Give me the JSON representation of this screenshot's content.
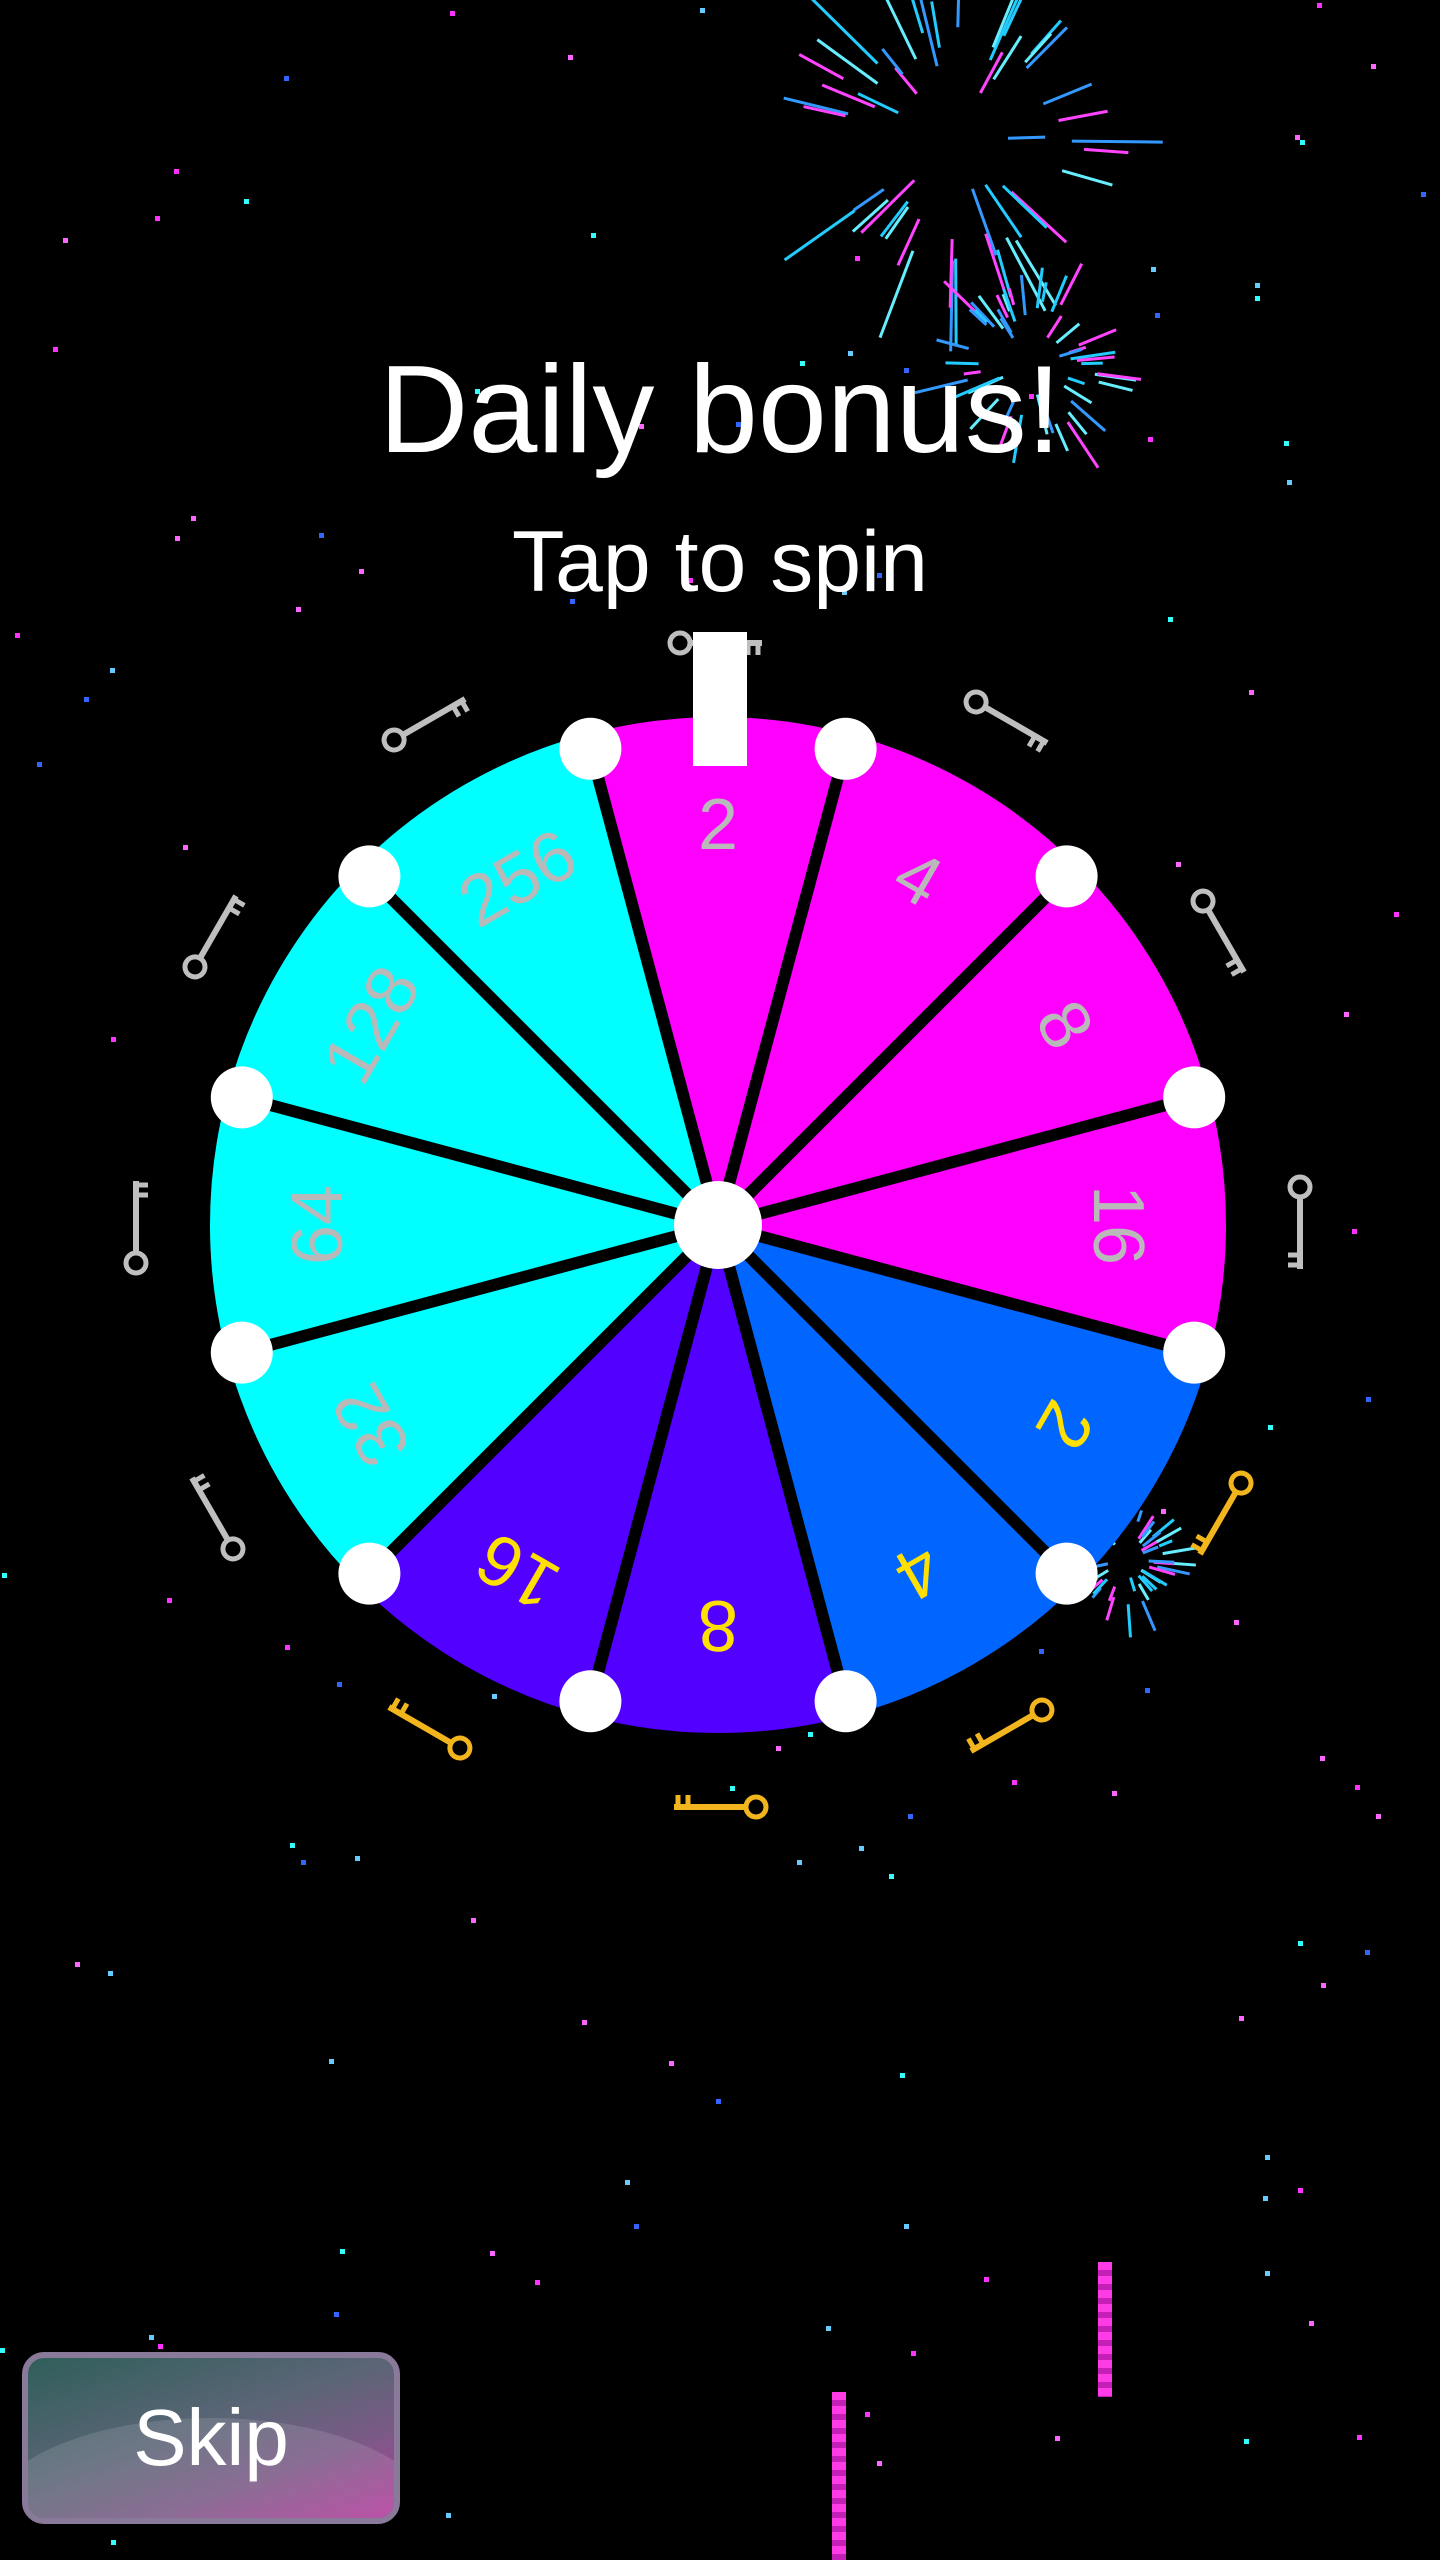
{
  "title": "Daily bonus!",
  "subtitle": "Tap to spin",
  "skip_label": "Skip",
  "wheel": {
    "segments": [
      {
        "value": "2",
        "color": "#ff00ff",
        "text_color": "#b9b9b9",
        "key": "silver"
      },
      {
        "value": "4",
        "color": "#ff00ff",
        "text_color": "#b9b9b9",
        "key": "silver"
      },
      {
        "value": "8",
        "color": "#ff00ff",
        "text_color": "#b9b9b9",
        "key": "silver"
      },
      {
        "value": "16",
        "color": "#ff00ff",
        "text_color": "#b9b9b9",
        "key": "silver"
      },
      {
        "value": "2",
        "color": "#0066ff",
        "text_color": "#ffe000",
        "key": "gold"
      },
      {
        "value": "4",
        "color": "#0066ff",
        "text_color": "#ffe000",
        "key": "gold"
      },
      {
        "value": "8",
        "color": "#5200ff",
        "text_color": "#ffe000",
        "key": "gold"
      },
      {
        "value": "16",
        "color": "#5200ff",
        "text_color": "#ffe000",
        "key": "gold"
      },
      {
        "value": "32",
        "color": "#00ffff",
        "text_color": "#b9b9b9",
        "key": "silver"
      },
      {
        "value": "64",
        "color": "#00ffff",
        "text_color": "#b9b9b9",
        "key": "silver"
      },
      {
        "value": "128",
        "color": "#00ffff",
        "text_color": "#b9b9b9",
        "key": "silver"
      },
      {
        "value": "256",
        "color": "#00ffff",
        "text_color": "#b9b9b9",
        "key": "silver"
      }
    ]
  },
  "colors": {
    "background": "#000000",
    "silver_key": "#bfbfbf",
    "gold_key": "#f2b51e",
    "peg": "#ffffff",
    "pointer": "#ffffff"
  },
  "icons": {
    "segment_reward": "key-icon",
    "pointer": "pointer-marker"
  }
}
